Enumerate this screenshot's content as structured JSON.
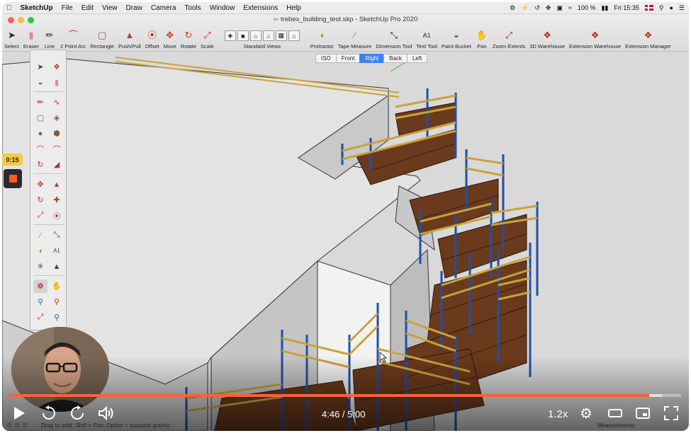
{
  "menubar": {
    "app": "SketchUp",
    "items": [
      "File",
      "Edit",
      "View",
      "Draw",
      "Camera",
      "Tools",
      "Window",
      "Extensions",
      "Help"
    ],
    "battery": "100 %",
    "clock": "Fri 15:35"
  },
  "window": {
    "title": "trebex_building_test.skp - SketchUp Pro 2020"
  },
  "toolbar": {
    "tools": [
      {
        "label": "Select",
        "icon": "arrow-pointer-icon"
      },
      {
        "label": "Eraser",
        "icon": "eraser-icon"
      },
      {
        "label": "Line",
        "icon": "pencil-icon"
      },
      {
        "label": "2 Point Arc",
        "icon": "arc-icon"
      },
      {
        "label": "Rectangle",
        "icon": "rectangle-icon"
      },
      {
        "label": "Push/Pull",
        "icon": "push-pull-icon"
      },
      {
        "label": "Offset",
        "icon": "offset-icon"
      },
      {
        "label": "Move",
        "icon": "move-icon"
      },
      {
        "label": "Rotate",
        "icon": "rotate-icon"
      },
      {
        "label": "Scale",
        "icon": "scale-icon"
      }
    ],
    "standard_views_label": "Standard Views",
    "tools_right": [
      {
        "label": "Protractor",
        "icon": "protractor-icon"
      },
      {
        "label": "Tape Measure",
        "icon": "tape-measure-icon"
      },
      {
        "label": "Dimension Tool",
        "icon": "dimension-icon"
      },
      {
        "label": "Text Tool",
        "icon": "text-tool-icon"
      },
      {
        "label": "Paint Bucket",
        "icon": "paint-bucket-icon"
      },
      {
        "label": "Pan",
        "icon": "pan-hand-icon"
      },
      {
        "label": "Zoom Extents",
        "icon": "zoom-extents-icon"
      },
      {
        "label": "3D Warehouse",
        "icon": "warehouse-icon"
      },
      {
        "label": "Extension Warehouse",
        "icon": "extension-warehouse-icon"
      },
      {
        "label": "Extension Manager",
        "icon": "extension-manager-icon"
      }
    ]
  },
  "view_tabs": [
    "ISO",
    "Front",
    "Right",
    "Back",
    "Left"
  ],
  "active_view": "Right",
  "recording": {
    "elapsed": "0:15"
  },
  "player": {
    "time": "4:46 / 5:00",
    "speed": "1.2x",
    "progress": 0.953,
    "buffered": 0.972
  },
  "statusbar": {
    "hint": "Drag to orbit. Shift = Pan, Option = suspend gravity.",
    "measurements_label": "Measurements"
  },
  "colors": {
    "progress": "#f5633a",
    "active_tab": "#3b82f6",
    "plank": "#6b3a1c",
    "frame_post": "#1f4fa8",
    "rail": "#c9a23a"
  }
}
